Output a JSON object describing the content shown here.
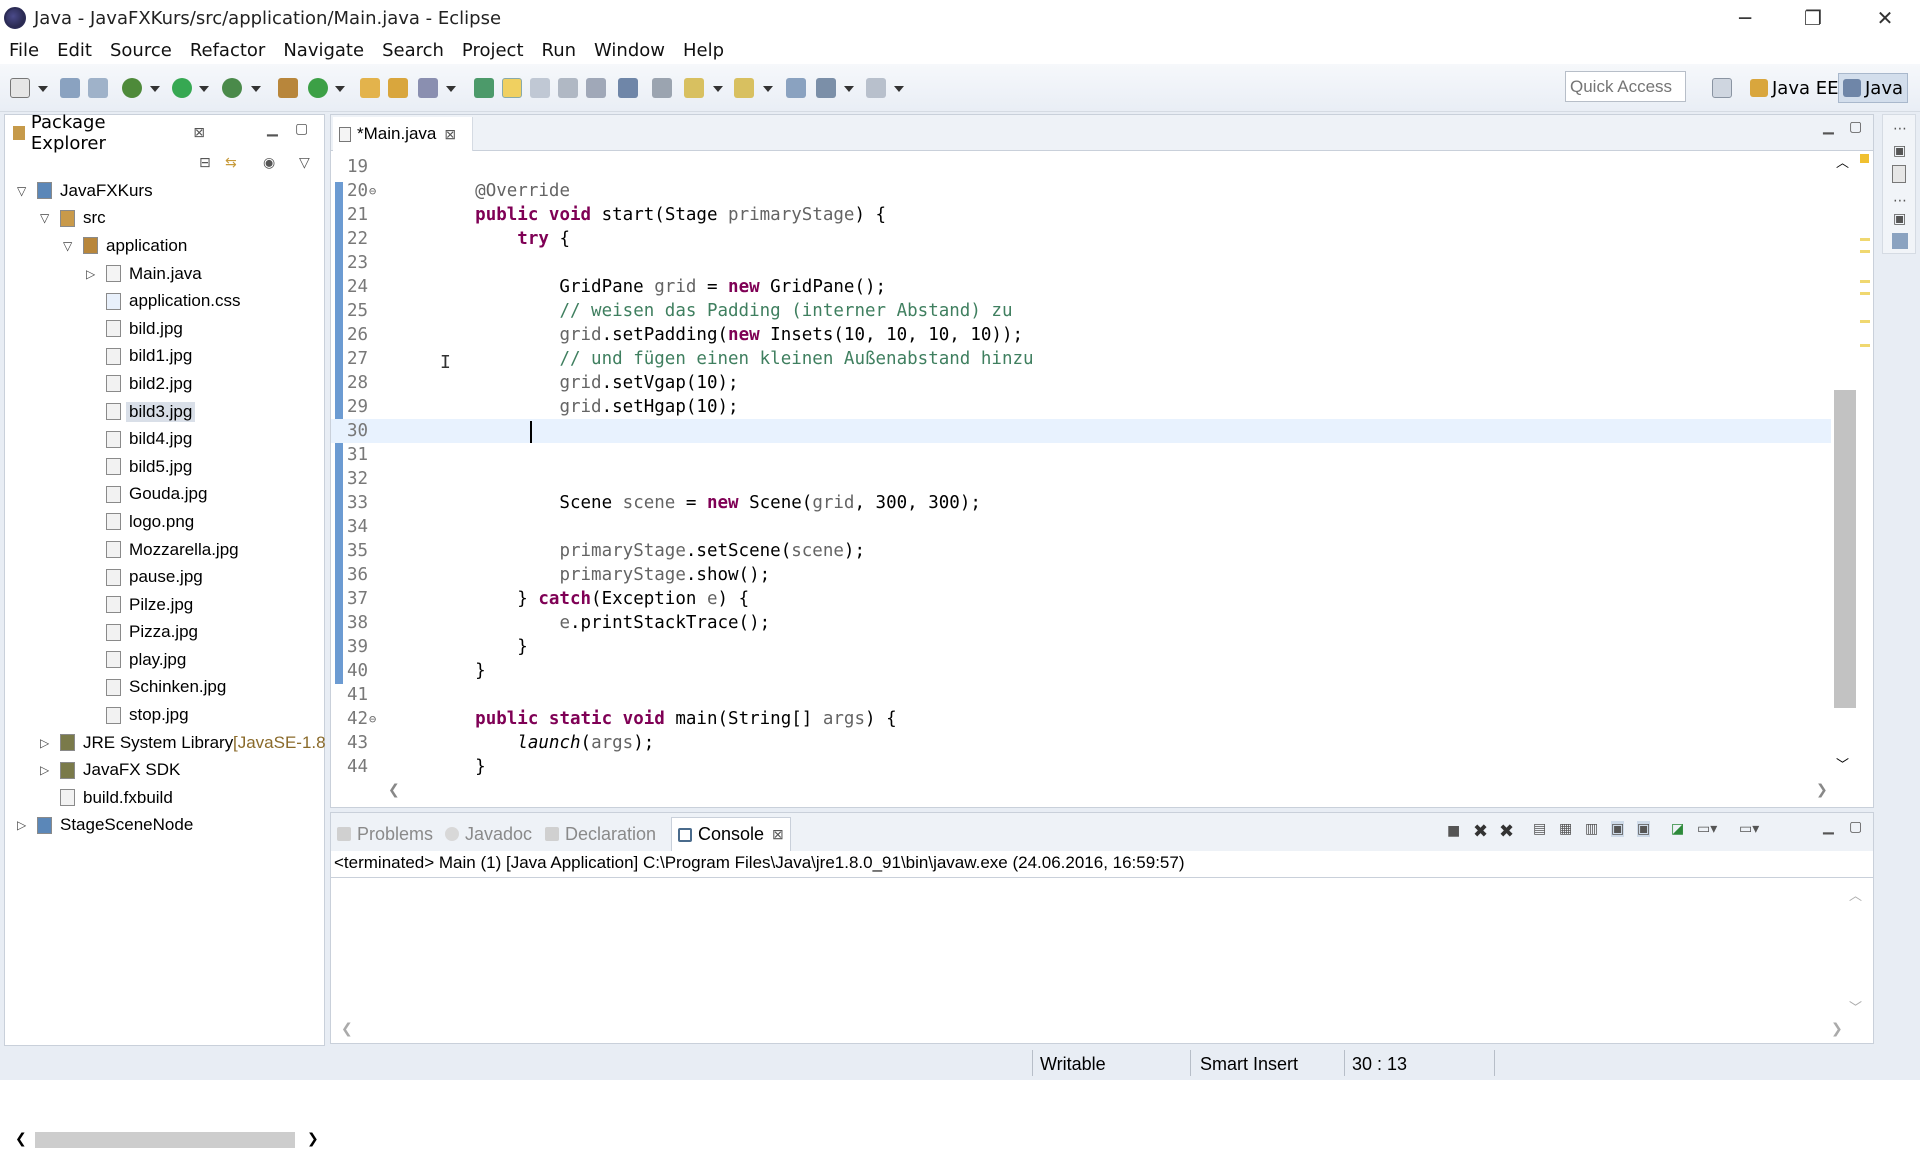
{
  "window": {
    "title": "Java - JavaFXKurs/src/application/Main.java - Eclipse",
    "controls": {
      "minimize": "─",
      "restore": "❐",
      "close": "✕"
    }
  },
  "menu": [
    "File",
    "Edit",
    "Source",
    "Refactor",
    "Navigate",
    "Search",
    "Project",
    "Run",
    "Window",
    "Help"
  ],
  "toolbar": {
    "quick_access_placeholder": "Quick Access",
    "perspectives": [
      "Java EE",
      "Java"
    ]
  },
  "package_explorer": {
    "title": "Package Explorer",
    "tree": [
      {
        "label": "JavaFXKurs",
        "depth": 0,
        "twisty": "down",
        "icon": "project-icon"
      },
      {
        "label": "src",
        "depth": 1,
        "twisty": "down",
        "icon": "source-folder-icon"
      },
      {
        "label": "application",
        "depth": 2,
        "twisty": "down",
        "icon": "package-icon"
      },
      {
        "label": "Main.java",
        "depth": 3,
        "twisty": "right",
        "icon": "java-file-icon"
      },
      {
        "label": "application.css",
        "depth": 3,
        "twisty": "",
        "icon": "css-file-icon"
      },
      {
        "label": "bild.jpg",
        "depth": 3,
        "twisty": "",
        "icon": "file-icon"
      },
      {
        "label": "bild1.jpg",
        "depth": 3,
        "twisty": "",
        "icon": "file-icon"
      },
      {
        "label": "bild2.jpg",
        "depth": 3,
        "twisty": "",
        "icon": "file-icon"
      },
      {
        "label": "bild3.jpg",
        "depth": 3,
        "twisty": "",
        "icon": "file-icon",
        "selected": true
      },
      {
        "label": "bild4.jpg",
        "depth": 3,
        "twisty": "",
        "icon": "file-icon"
      },
      {
        "label": "bild5.jpg",
        "depth": 3,
        "twisty": "",
        "icon": "file-icon"
      },
      {
        "label": "Gouda.jpg",
        "depth": 3,
        "twisty": "",
        "icon": "file-icon"
      },
      {
        "label": "logo.png",
        "depth": 3,
        "twisty": "",
        "icon": "file-icon"
      },
      {
        "label": "Mozzarella.jpg",
        "depth": 3,
        "twisty": "",
        "icon": "file-icon"
      },
      {
        "label": "pause.jpg",
        "depth": 3,
        "twisty": "",
        "icon": "file-icon"
      },
      {
        "label": "Pilze.jpg",
        "depth": 3,
        "twisty": "",
        "icon": "file-icon"
      },
      {
        "label": "Pizza.jpg",
        "depth": 3,
        "twisty": "",
        "icon": "file-icon"
      },
      {
        "label": "play.jpg",
        "depth": 3,
        "twisty": "",
        "icon": "file-icon"
      },
      {
        "label": "Schinken.jpg",
        "depth": 3,
        "twisty": "",
        "icon": "file-icon"
      },
      {
        "label": "stop.jpg",
        "depth": 3,
        "twisty": "",
        "icon": "file-icon"
      },
      {
        "label": "JRE System Library",
        "suffix": "[JavaSE-1.8",
        "depth": 1,
        "twisty": "right",
        "icon": "library-icon"
      },
      {
        "label": "JavaFX SDK",
        "depth": 1,
        "twisty": "right",
        "icon": "library-icon"
      },
      {
        "label": "build.fxbuild",
        "depth": 1,
        "twisty": "",
        "icon": "file-icon"
      },
      {
        "label": "StageSceneNode",
        "depth": 0,
        "twisty": "right",
        "icon": "project-icon"
      }
    ]
  },
  "editor": {
    "tab_label": "*Main.java",
    "lines": [
      {
        "n": "19",
        "parts": []
      },
      {
        "n": "20",
        "fold": "⊖",
        "parts": [
          {
            "t": "    "
          },
          {
            "t": "@Override",
            "c": "an"
          }
        ]
      },
      {
        "n": "21",
        "parts": [
          {
            "t": "    "
          },
          {
            "t": "public void",
            "c": "kw"
          },
          {
            "t": " start(Stage "
          },
          {
            "t": "primaryStage",
            "c": "an"
          },
          {
            "t": ") {"
          }
        ]
      },
      {
        "n": "22",
        "parts": [
          {
            "t": "        "
          },
          {
            "t": "try",
            "c": "kw"
          },
          {
            "t": " {"
          }
        ]
      },
      {
        "n": "23",
        "parts": []
      },
      {
        "n": "24",
        "parts": [
          {
            "t": "            GridPane "
          },
          {
            "t": "grid",
            "c": "an"
          },
          {
            "t": " = "
          },
          {
            "t": "new",
            "c": "kw"
          },
          {
            "t": " GridPane();"
          }
        ]
      },
      {
        "n": "25",
        "parts": [
          {
            "t": "            "
          },
          {
            "t": "// weisen das Padding (interner Abstand) zu",
            "c": "cm"
          }
        ]
      },
      {
        "n": "26",
        "parts": [
          {
            "t": "            "
          },
          {
            "t": "grid",
            "c": "an"
          },
          {
            "t": ".setPadding("
          },
          {
            "t": "new",
            "c": "kw"
          },
          {
            "t": " Insets(10, 10, 10, 10));"
          }
        ]
      },
      {
        "n": "27",
        "parts": [
          {
            "t": "            "
          },
          {
            "t": "// und fügen einen kleinen Außenabstand hinzu",
            "c": "cm"
          }
        ]
      },
      {
        "n": "28",
        "parts": [
          {
            "t": "            "
          },
          {
            "t": "grid",
            "c": "an"
          },
          {
            "t": ".setVgap(10);"
          }
        ]
      },
      {
        "n": "29",
        "parts": [
          {
            "t": "            "
          },
          {
            "t": "grid",
            "c": "an"
          },
          {
            "t": ".setHgap(10);"
          }
        ]
      },
      {
        "n": "30",
        "current": true,
        "parts": []
      },
      {
        "n": "31",
        "parts": []
      },
      {
        "n": "32",
        "parts": []
      },
      {
        "n": "33",
        "parts": [
          {
            "t": "            Scene "
          },
          {
            "t": "scene",
            "c": "an"
          },
          {
            "t": " = "
          },
          {
            "t": "new",
            "c": "kw"
          },
          {
            "t": " Scene("
          },
          {
            "t": "grid",
            "c": "an"
          },
          {
            "t": ", 300, 300);"
          }
        ]
      },
      {
        "n": "34",
        "parts": []
      },
      {
        "n": "35",
        "parts": [
          {
            "t": "            "
          },
          {
            "t": "primaryStage",
            "c": "an"
          },
          {
            "t": ".setScene("
          },
          {
            "t": "scene",
            "c": "an"
          },
          {
            "t": ");"
          }
        ]
      },
      {
        "n": "36",
        "parts": [
          {
            "t": "            "
          },
          {
            "t": "primaryStage",
            "c": "an"
          },
          {
            "t": ".show();"
          }
        ]
      },
      {
        "n": "37",
        "parts": [
          {
            "t": "        } "
          },
          {
            "t": "catch",
            "c": "kw"
          },
          {
            "t": "(Exception "
          },
          {
            "t": "e",
            "c": "an"
          },
          {
            "t": ") {"
          }
        ]
      },
      {
        "n": "38",
        "parts": [
          {
            "t": "            "
          },
          {
            "t": "e",
            "c": "an"
          },
          {
            "t": ".printStackTrace();"
          }
        ]
      },
      {
        "n": "39",
        "parts": [
          {
            "t": "        }"
          }
        ]
      },
      {
        "n": "40",
        "parts": [
          {
            "t": "    }"
          }
        ]
      },
      {
        "n": "41",
        "parts": []
      },
      {
        "n": "42",
        "fold": "⊖",
        "parts": [
          {
            "t": "    "
          },
          {
            "t": "public static void",
            "c": "kw"
          },
          {
            "t": " main(String[] "
          },
          {
            "t": "args",
            "c": "an"
          },
          {
            "t": ") {"
          }
        ]
      },
      {
        "n": "43",
        "parts": [
          {
            "t": "        "
          },
          {
            "t": "launch",
            "c": "it"
          },
          {
            "t": "("
          },
          {
            "t": "args",
            "c": "an"
          },
          {
            "t": ");"
          }
        ]
      },
      {
        "n": "44",
        "parts": [
          {
            "t": "    }"
          }
        ]
      }
    ]
  },
  "bottom_panel": {
    "tabs": [
      {
        "label": "Problems",
        "active": false
      },
      {
        "label": "Javadoc",
        "active": false
      },
      {
        "label": "Declaration",
        "active": false
      },
      {
        "label": "Console",
        "active": true
      }
    ],
    "console_status": "<terminated> Main (1) [Java Application] C:\\Program Files\\Java\\jre1.8.0_91\\bin\\javaw.exe (24.06.2016, 16:59:57)"
  },
  "statusbar": {
    "mode": "Writable",
    "insert_mode": "Smart Insert",
    "position": "30 : 13"
  },
  "colors": {
    "keyword": "#7f0055",
    "comment": "#3f7f5f",
    "field": "#646464",
    "current_line": "#e8f2fe",
    "selection": "#d9dfe8"
  }
}
